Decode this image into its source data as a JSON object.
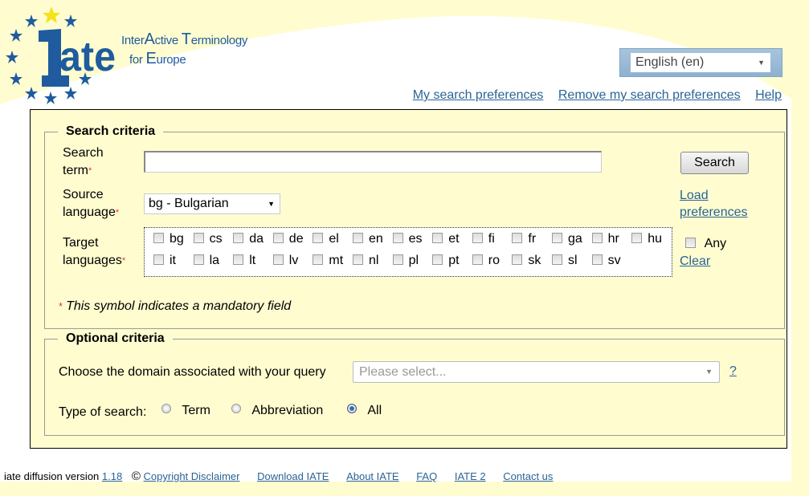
{
  "header": {
    "logo_brand": "iate",
    "logo_line1": [
      "Inter",
      "A",
      "ctive ",
      "T",
      "erminology"
    ],
    "logo_line2": [
      "for ",
      "E",
      "urope"
    ],
    "language_selector": "English (en)",
    "links": [
      "My search preferences",
      "Remove my search preferences",
      "Help"
    ]
  },
  "search_criteria": {
    "legend": "Search criteria",
    "search_term_label_1": "Search",
    "search_term_label_2": "term",
    "search_term_value": "",
    "search_button": "Search",
    "source_language_label_1": "Source",
    "source_language_label_2": "language",
    "source_language_value": "bg - Bulgarian",
    "load_preferences_1": "Load",
    "load_preferences_2": "preferences",
    "target_languages_label_1": "Target",
    "target_languages_label_2": "languages",
    "target_languages": [
      [
        "bg",
        "cs",
        "da",
        "de",
        "el",
        "en",
        "es",
        "et",
        "fi",
        "fr",
        "ga",
        "hr",
        "hu"
      ],
      [
        "it",
        "la",
        "lt",
        "lv",
        "mt",
        "nl",
        "pl",
        "pt",
        "ro",
        "sk",
        "sl",
        "sv"
      ]
    ],
    "any_label": "Any",
    "clear_link": "Clear",
    "required_marker": "*",
    "mandatory_note": "This symbol indicates a mandatory field"
  },
  "optional_criteria": {
    "legend": "Optional criteria",
    "domain_label": "Choose the domain associated with your query",
    "domain_placeholder": "Please select...",
    "domain_help": "?",
    "type_label": "Type of search:",
    "types": [
      "Term",
      "Abbreviation",
      "All"
    ],
    "selected_type": "All"
  },
  "footer": {
    "version_label": "iate diffusion version",
    "version": "1.18",
    "copyright_symbol": "©",
    "links": [
      "Copyright Disclaimer",
      "Download IATE",
      "About IATE",
      "FAQ",
      "IATE 2",
      "Contact us"
    ]
  },
  "colors": {
    "background": "#fffdd0",
    "brand_blue": "#1f5b9e",
    "link": "#2a6496",
    "star_yellow": "#f5e21a"
  }
}
